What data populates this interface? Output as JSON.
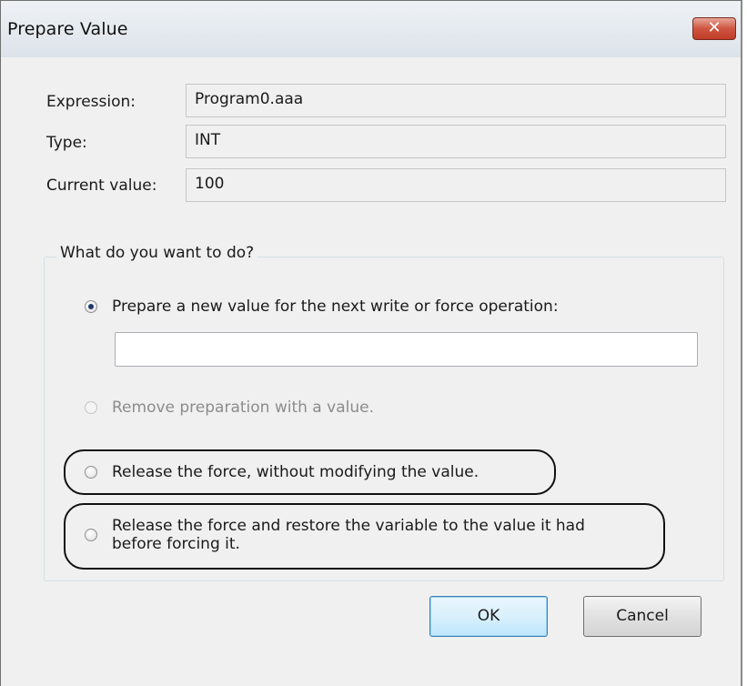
{
  "window": {
    "title": "Prepare Value",
    "close_glyph": "✕"
  },
  "fields": [
    {
      "label": "Expression:",
      "value": "Program0.aaa"
    },
    {
      "label": "Type:",
      "value": "INT"
    },
    {
      "label": "Current value:",
      "value": "100"
    }
  ],
  "group": {
    "title": "What do you want to do?",
    "options": [
      {
        "label": "Prepare a new value for the next write or force operation:",
        "checked": true,
        "enabled": true
      },
      {
        "label": "Remove preparation with a value.",
        "checked": false,
        "enabled": false
      },
      {
        "label": "Release the force, without modifying the value.",
        "checked": false,
        "enabled": true
      },
      {
        "label_line1": "Release the force and restore the variable to the value it had",
        "label_line2": "before forcing it.",
        "checked": false,
        "enabled": true
      }
    ],
    "new_value": ""
  },
  "buttons": {
    "ok": "OK",
    "cancel": "Cancel"
  },
  "colors": {
    "close_button": "#cf5540",
    "default_button_border": "#3c7fb1",
    "highlight_outline": "#111111"
  }
}
